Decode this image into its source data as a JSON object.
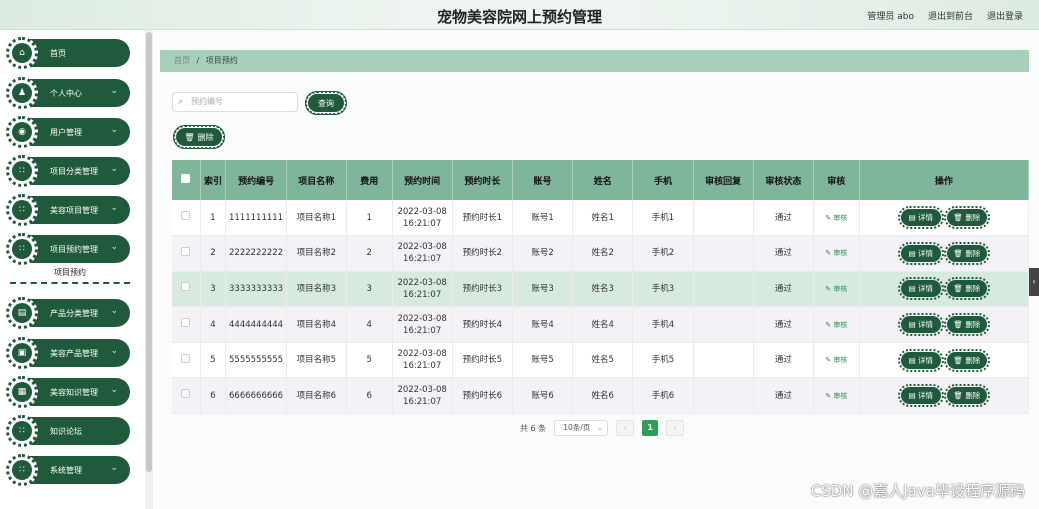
{
  "header": {
    "title": "宠物美容院网上预约管理",
    "admin": "管理员 abo",
    "back_front": "退出到前台",
    "logout": "退出登录"
  },
  "sidebar": {
    "items": [
      {
        "label": "首页",
        "icon": "home-icon",
        "glyph": "⌂",
        "has_arrow": false
      },
      {
        "label": "个人中心",
        "icon": "user-icon",
        "glyph": "♟",
        "has_arrow": true
      },
      {
        "label": "用户管理",
        "icon": "location-icon",
        "glyph": "◉",
        "has_arrow": true
      },
      {
        "label": "项目分类管理",
        "icon": "grid-icon",
        "glyph": "∷",
        "has_arrow": true
      },
      {
        "label": "美容项目管理",
        "icon": "grid-icon",
        "glyph": "∷",
        "has_arrow": true
      },
      {
        "label": "项目预约管理",
        "icon": "grid-icon",
        "glyph": "∷",
        "has_arrow": true
      },
      {
        "label": "产品分类管理",
        "icon": "folder-icon",
        "glyph": "▤",
        "has_arrow": true
      },
      {
        "label": "美容产品管理",
        "icon": "box-icon",
        "glyph": "▣",
        "has_arrow": true
      },
      {
        "label": "美容知识管理",
        "icon": "film-icon",
        "glyph": "▦",
        "has_arrow": true
      },
      {
        "label": "知识论坛",
        "icon": "grid-icon",
        "glyph": "∷",
        "has_arrow": false
      },
      {
        "label": "系统管理",
        "icon": "grid-icon",
        "glyph": "∷",
        "has_arrow": true
      }
    ],
    "submenu_active": "项目预约"
  },
  "breadcrumb": {
    "home": "首页",
    "sep": "/",
    "current": "项目预约"
  },
  "search": {
    "placeholder": "预约编号",
    "query_label": "查询"
  },
  "toolbar": {
    "delete_label": "删除"
  },
  "table": {
    "columns": [
      "索引",
      "预约编号",
      "项目名称",
      "费用",
      "预约时间",
      "预约时长",
      "账号",
      "姓名",
      "手机",
      "审核回复",
      "审核状态",
      "审核",
      "操作"
    ],
    "rows": [
      {
        "index": "1",
        "code": "1111111111",
        "name": "项目名称1",
        "fee": "1",
        "time": "2022-03-08 16:21:07",
        "duration": "预约时长1",
        "account": "账号1",
        "person": "姓名1",
        "phone": "手机1",
        "reply": "",
        "status": "通过"
      },
      {
        "index": "2",
        "code": "2222222222",
        "name": "项目名称2",
        "fee": "2",
        "time": "2022-03-08 16:21:07",
        "duration": "预约时长2",
        "account": "账号2",
        "person": "姓名2",
        "phone": "手机2",
        "reply": "",
        "status": "通过"
      },
      {
        "index": "3",
        "code": "3333333333",
        "name": "项目名称3",
        "fee": "3",
        "time": "2022-03-08 16:21:07",
        "duration": "预约时长3",
        "account": "账号3",
        "person": "姓名3",
        "phone": "手机3",
        "reply": "",
        "status": "通过"
      },
      {
        "index": "4",
        "code": "4444444444",
        "name": "项目名称4",
        "fee": "4",
        "time": "2022-03-08 16:21:07",
        "duration": "预约时长4",
        "account": "账号4",
        "person": "姓名4",
        "phone": "手机4",
        "reply": "",
        "status": "通过"
      },
      {
        "index": "5",
        "code": "5555555555",
        "name": "项目名称5",
        "fee": "5",
        "time": "2022-03-08 16:21:07",
        "duration": "预约时长5",
        "account": "账号5",
        "person": "姓名5",
        "phone": "手机5",
        "reply": "",
        "status": "通过"
      },
      {
        "index": "6",
        "code": "6666666666",
        "name": "项目名称6",
        "fee": "6",
        "time": "2022-03-08 16:21:07",
        "duration": "预约时长6",
        "account": "账号6",
        "person": "姓名6",
        "phone": "手机6",
        "reply": "",
        "status": "通过"
      }
    ],
    "audit_link": "审核",
    "detail_label": "详情",
    "delete_label": "删除"
  },
  "pagination": {
    "total": "共 6 条",
    "page_size": "10条/页",
    "current_page": "1",
    "prev": "‹",
    "next": "›"
  },
  "watermark": "CSDN @嘉人Java毕设程序源码",
  "colors": {
    "primary": "#1f5a3c",
    "header_row": "#7fb59a",
    "breadcrumb": "#a8cfb9",
    "active_page": "#2e9e5b"
  }
}
